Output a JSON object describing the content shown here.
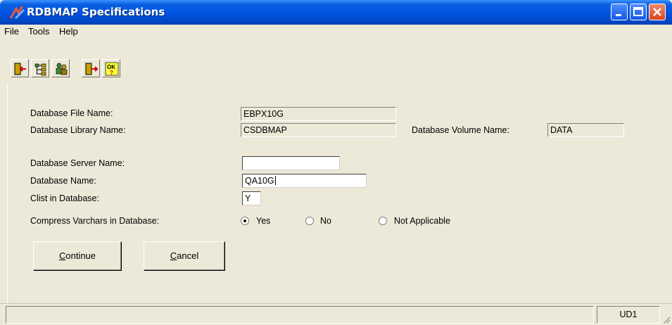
{
  "window": {
    "title": "RDBMAP Specifications"
  },
  "menu": {
    "items": [
      {
        "label": "File"
      },
      {
        "label": "Tools"
      },
      {
        "label": "Help"
      }
    ]
  },
  "toolbar": {
    "buttons": [
      {
        "icon": "exit-icon"
      },
      {
        "icon": "tree-icon"
      },
      {
        "icon": "people-icon"
      },
      {
        "icon": "export-icon"
      },
      {
        "icon": "ok-help-icon",
        "label": "OK"
      }
    ]
  },
  "form": {
    "db_file_name": {
      "label": "Database File Name:",
      "value": "EBPX10G"
    },
    "db_library_name": {
      "label": "Database Library Name:",
      "value": "CSDBMAP"
    },
    "db_volume_name": {
      "label": "Database Volume Name:",
      "value": "DATA"
    },
    "db_server_name": {
      "label": "Database Server Name:",
      "value": ""
    },
    "db_name": {
      "label": "Database Name:",
      "value": "QA10G"
    },
    "clist": {
      "label": "Clist in Database:",
      "value": "Y"
    },
    "compress": {
      "label": "Compress Varchars in Database:",
      "options": [
        {
          "label": "Yes",
          "selected": true
        },
        {
          "label": "No",
          "selected": false
        },
        {
          "label": "Not Applicable",
          "selected": false
        }
      ]
    }
  },
  "buttons": {
    "continue": {
      "mnemonic": "C",
      "rest": "ontinue"
    },
    "cancel": {
      "mnemonic": "C",
      "rest": "ancel"
    }
  },
  "status": {
    "main": "",
    "cell": "UD1"
  },
  "colors": {
    "titlebar": "#0054e3",
    "face": "#ece9d8",
    "close": "#d9421d"
  }
}
